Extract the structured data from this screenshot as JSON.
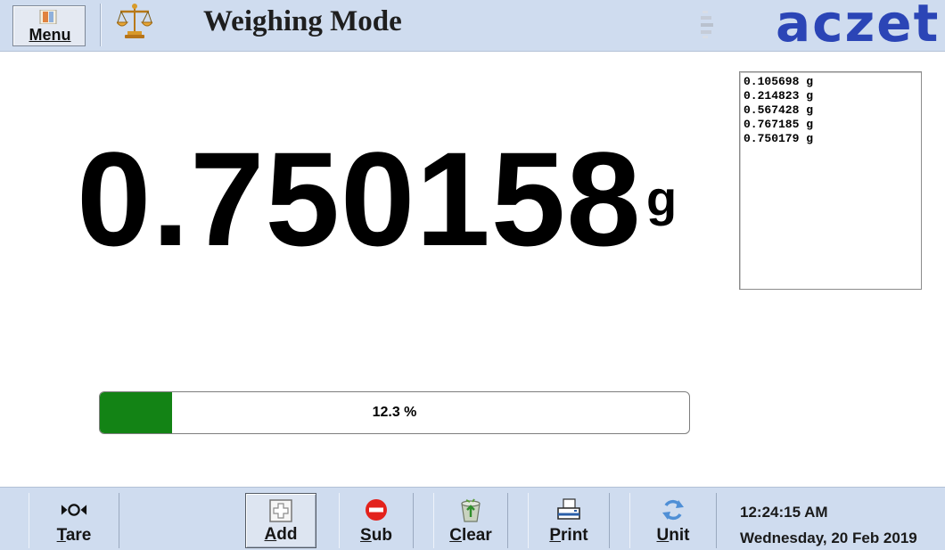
{
  "header": {
    "menu_label": "Menu",
    "title": "Weighing Mode",
    "logo_text": "aczet",
    "logo_color": "#2b45b6",
    "background": "#cfdcef"
  },
  "reading": {
    "value": "0.750158",
    "unit": "g"
  },
  "log": {
    "items": [
      "0.105698 g",
      "0.214823 g",
      "0.567428 g",
      "0.767185 g",
      "0.750179 g"
    ]
  },
  "progress": {
    "percent": 12.3,
    "label": "12.3 %",
    "fill_color": "#138315"
  },
  "toolbar": {
    "buttons": [
      {
        "mnemonic": "T",
        "rest": "are",
        "icon": "tare-icon"
      },
      {
        "mnemonic": "A",
        "rest": "dd",
        "icon": "plus-icon"
      },
      {
        "mnemonic": "S",
        "rest": "ub",
        "icon": "minus-circle-icon"
      },
      {
        "mnemonic": "C",
        "rest": "lear",
        "icon": "recycle-bin-icon"
      },
      {
        "mnemonic": "P",
        "rest": "rint",
        "icon": "printer-icon"
      },
      {
        "mnemonic": "U",
        "rest": "nit",
        "icon": "refresh-icon"
      }
    ],
    "time": "12:24:15 AM",
    "date": "Wednesday, 20 Feb 2019"
  }
}
